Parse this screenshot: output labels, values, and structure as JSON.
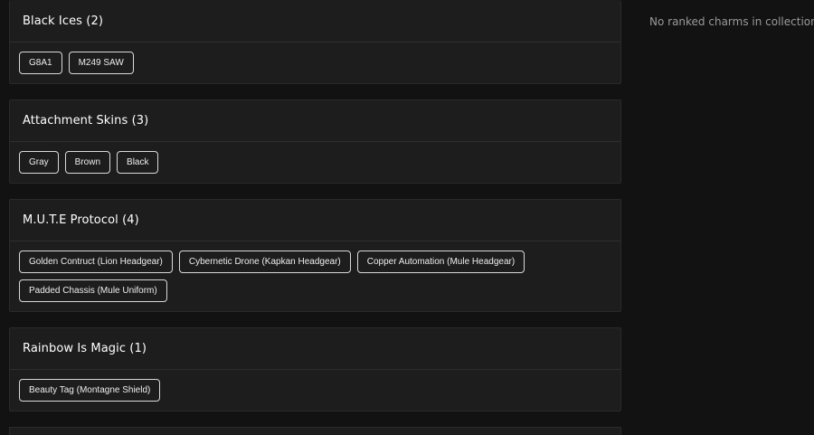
{
  "collections": [
    {
      "title": "Black Ices (2)",
      "items": [
        "G8A1",
        "M249 SAW"
      ]
    },
    {
      "title": "Attachment Skins (3)",
      "items": [
        "Gray",
        "Brown",
        "Black"
      ]
    },
    {
      "title": "M.U.T.E Protocol (4)",
      "items": [
        "Golden Contruct (Lion Headgear)",
        "Cybernetic Drone (Kapkan Headgear)",
        "Copper Automation (Mule Headgear)",
        "Padded Chassis (Mule Uniform)"
      ]
    },
    {
      "title": "Rainbow Is Magic (1)",
      "items": [
        "Beauty Tag (Montagne Shield)"
      ]
    }
  ],
  "sidebar": {
    "empty_message": "No ranked charms in collection"
  }
}
